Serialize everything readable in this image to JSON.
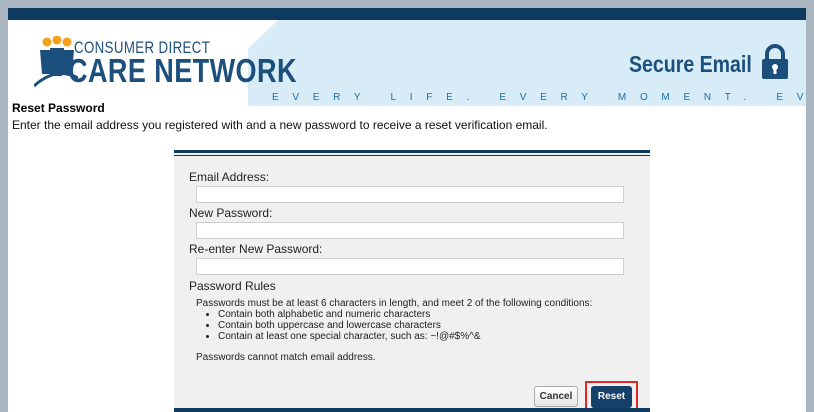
{
  "header": {
    "logo_line1": "CONSUMER DIRECT",
    "logo_line2": "CARE NETWORK",
    "title": "Secure Email",
    "tagline": "EVERY LIFE. EVERY MOMENT. EVERY DAY.",
    "logo_icon": "people-icon",
    "title_icon": "lock-icon"
  },
  "page": {
    "heading": "Reset Password",
    "intro": "Enter the email address you registered with and a new password to receive a reset verification email."
  },
  "form": {
    "email_label": "Email Address:",
    "email_value": "",
    "new_password_label": "New Password:",
    "new_password_value": "",
    "reenter_label": "Re-enter New Password:",
    "reenter_value": "",
    "rules_title": "Password Rules",
    "rules_intro": "Passwords must be at least 6 characters in length, and meet 2 of the following conditions:",
    "rules": [
      "Contain both alphabetic and numeric characters",
      "Contain both uppercase and lowercase characters",
      "Contain at least one special character, such as: ~!@#$%^&"
    ],
    "rules_note": "Passwords cannot match email address.",
    "cancel_label": "Cancel",
    "reset_label": "Reset"
  },
  "colors": {
    "navy": "#0e3a60",
    "brand_blue": "#1c4f7c",
    "banner_bg": "#d7ecf7",
    "highlight": "#e32727"
  }
}
